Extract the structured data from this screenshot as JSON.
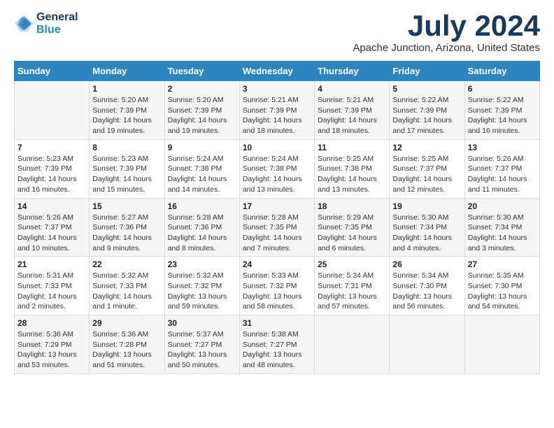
{
  "logo": {
    "line1": "General",
    "line2": "Blue"
  },
  "title": "July 2024",
  "location": "Apache Junction, Arizona, United States",
  "weekdays": [
    "Sunday",
    "Monday",
    "Tuesday",
    "Wednesday",
    "Thursday",
    "Friday",
    "Saturday"
  ],
  "weeks": [
    [
      {
        "day": "",
        "info": ""
      },
      {
        "day": "1",
        "info": "Sunrise: 5:20 AM\nSunset: 7:39 PM\nDaylight: 14 hours\nand 19 minutes."
      },
      {
        "day": "2",
        "info": "Sunrise: 5:20 AM\nSunset: 7:39 PM\nDaylight: 14 hours\nand 19 minutes."
      },
      {
        "day": "3",
        "info": "Sunrise: 5:21 AM\nSunset: 7:39 PM\nDaylight: 14 hours\nand 18 minutes."
      },
      {
        "day": "4",
        "info": "Sunrise: 5:21 AM\nSunset: 7:39 PM\nDaylight: 14 hours\nand 18 minutes."
      },
      {
        "day": "5",
        "info": "Sunrise: 5:22 AM\nSunset: 7:39 PM\nDaylight: 14 hours\nand 17 minutes."
      },
      {
        "day": "6",
        "info": "Sunrise: 5:22 AM\nSunset: 7:39 PM\nDaylight: 14 hours\nand 16 minutes."
      }
    ],
    [
      {
        "day": "7",
        "info": "Sunrise: 5:23 AM\nSunset: 7:39 PM\nDaylight: 14 hours\nand 16 minutes."
      },
      {
        "day": "8",
        "info": "Sunrise: 5:23 AM\nSunset: 7:39 PM\nDaylight: 14 hours\nand 15 minutes."
      },
      {
        "day": "9",
        "info": "Sunrise: 5:24 AM\nSunset: 7:38 PM\nDaylight: 14 hours\nand 14 minutes."
      },
      {
        "day": "10",
        "info": "Sunrise: 5:24 AM\nSunset: 7:38 PM\nDaylight: 14 hours\nand 13 minutes."
      },
      {
        "day": "11",
        "info": "Sunrise: 5:25 AM\nSunset: 7:38 PM\nDaylight: 14 hours\nand 13 minutes."
      },
      {
        "day": "12",
        "info": "Sunrise: 5:25 AM\nSunset: 7:37 PM\nDaylight: 14 hours\nand 12 minutes."
      },
      {
        "day": "13",
        "info": "Sunrise: 5:26 AM\nSunset: 7:37 PM\nDaylight: 14 hours\nand 11 minutes."
      }
    ],
    [
      {
        "day": "14",
        "info": "Sunrise: 5:26 AM\nSunset: 7:37 PM\nDaylight: 14 hours\nand 10 minutes."
      },
      {
        "day": "15",
        "info": "Sunrise: 5:27 AM\nSunset: 7:36 PM\nDaylight: 14 hours\nand 9 minutes."
      },
      {
        "day": "16",
        "info": "Sunrise: 5:28 AM\nSunset: 7:36 PM\nDaylight: 14 hours\nand 8 minutes."
      },
      {
        "day": "17",
        "info": "Sunrise: 5:28 AM\nSunset: 7:35 PM\nDaylight: 14 hours\nand 7 minutes."
      },
      {
        "day": "18",
        "info": "Sunrise: 5:29 AM\nSunset: 7:35 PM\nDaylight: 14 hours\nand 6 minutes."
      },
      {
        "day": "19",
        "info": "Sunrise: 5:30 AM\nSunset: 7:34 PM\nDaylight: 14 hours\nand 4 minutes."
      },
      {
        "day": "20",
        "info": "Sunrise: 5:30 AM\nSunset: 7:34 PM\nDaylight: 14 hours\nand 3 minutes."
      }
    ],
    [
      {
        "day": "21",
        "info": "Sunrise: 5:31 AM\nSunset: 7:33 PM\nDaylight: 14 hours\nand 2 minutes."
      },
      {
        "day": "22",
        "info": "Sunrise: 5:32 AM\nSunset: 7:33 PM\nDaylight: 14 hours\nand 1 minute."
      },
      {
        "day": "23",
        "info": "Sunrise: 5:32 AM\nSunset: 7:32 PM\nDaylight: 13 hours\nand 59 minutes."
      },
      {
        "day": "24",
        "info": "Sunrise: 5:33 AM\nSunset: 7:32 PM\nDaylight: 13 hours\nand 58 minutes."
      },
      {
        "day": "25",
        "info": "Sunrise: 5:34 AM\nSunset: 7:31 PM\nDaylight: 13 hours\nand 57 minutes."
      },
      {
        "day": "26",
        "info": "Sunrise: 5:34 AM\nSunset: 7:30 PM\nDaylight: 13 hours\nand 56 minutes."
      },
      {
        "day": "27",
        "info": "Sunrise: 5:35 AM\nSunset: 7:30 PM\nDaylight: 13 hours\nand 54 minutes."
      }
    ],
    [
      {
        "day": "28",
        "info": "Sunrise: 5:36 AM\nSunset: 7:29 PM\nDaylight: 13 hours\nand 53 minutes."
      },
      {
        "day": "29",
        "info": "Sunrise: 5:36 AM\nSunset: 7:28 PM\nDaylight: 13 hours\nand 51 minutes."
      },
      {
        "day": "30",
        "info": "Sunrise: 5:37 AM\nSunset: 7:27 PM\nDaylight: 13 hours\nand 50 minutes."
      },
      {
        "day": "31",
        "info": "Sunrise: 5:38 AM\nSunset: 7:27 PM\nDaylight: 13 hours\nand 48 minutes."
      },
      {
        "day": "",
        "info": ""
      },
      {
        "day": "",
        "info": ""
      },
      {
        "day": "",
        "info": ""
      }
    ]
  ]
}
